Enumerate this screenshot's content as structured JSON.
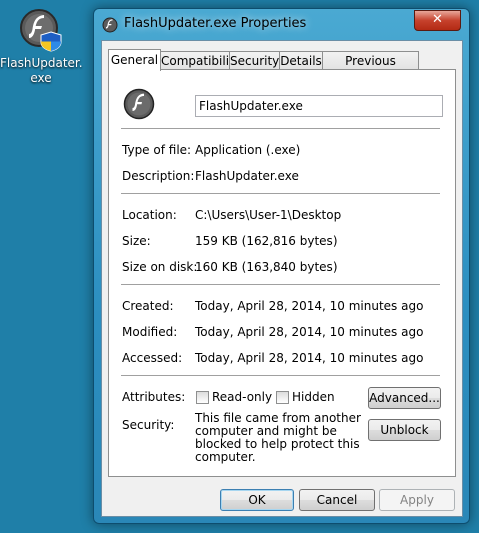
{
  "desktop": {
    "icon_label": "FlashUpdater.\nexe",
    "icon": "flash-shield-icon"
  },
  "window": {
    "title": "FlashUpdater.exe Properties",
    "close_label": "✕"
  },
  "tabs": [
    "General",
    "Compatibility",
    "Security",
    "Details",
    "Previous Versions"
  ],
  "general": {
    "file_name": "FlashUpdater.exe",
    "type_label": "Type of file:",
    "type_value": "Application (.exe)",
    "desc_label": "Description:",
    "desc_value": "FlashUpdater.exe",
    "loc_label": "Location:",
    "loc_value": "C:\\Users\\User-1\\Desktop",
    "size_label": "Size:",
    "size_value": "159 KB (162,816 bytes)",
    "disk_label": "Size on disk:",
    "disk_value": "160 KB (163,840 bytes)",
    "created_label": "Created:",
    "created_value": "Today, April 28, 2014, 10 minutes ago",
    "modified_label": "Modified:",
    "modified_value": "Today, April 28, 2014, 10 minutes ago",
    "accessed_label": "Accessed:",
    "accessed_value": "Today, April 28, 2014, 10 minutes ago",
    "attr_label": "Attributes:",
    "readonly_label": "Read-only",
    "hidden_label": "Hidden",
    "advanced_label": "Advanced...",
    "security_label": "Security:",
    "security_text": "This file came from another computer and might be blocked to help protect this computer.",
    "unblock_label": "Unblock"
  },
  "footer": {
    "ok": "OK",
    "cancel": "Cancel",
    "apply": "Apply"
  }
}
